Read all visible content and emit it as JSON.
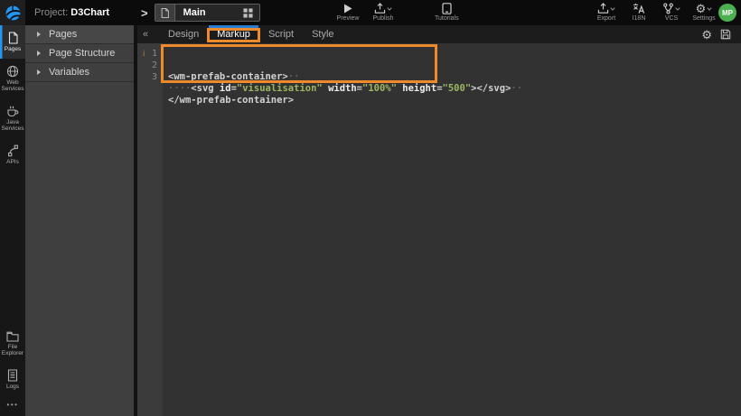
{
  "colors": {
    "annotation_orange": "#ee8a2b",
    "active_tab_blue": "#2b7cd3",
    "sidebar_active_blue": "#2196f3",
    "avatar_green": "#4caf50",
    "code_string_green": "#9db661"
  },
  "topbar": {
    "project_label": "Project:",
    "project_name": "D3Chart",
    "breadcrumb_chevron": ">",
    "file_tab": {
      "label": "Main"
    },
    "center_actions": [
      {
        "id": "preview",
        "label": "Preview",
        "icon": "play-icon",
        "caret": false
      },
      {
        "id": "publish",
        "label": "Publish",
        "icon": "publish-icon",
        "caret": true
      },
      {
        "id": "tutorials",
        "label": "Tutorials",
        "icon": "tutorials-icon",
        "caret": false
      }
    ],
    "right_actions": [
      {
        "id": "export",
        "label": "Export",
        "icon": "export-icon",
        "caret": true
      },
      {
        "id": "i18n",
        "label": "I18N",
        "icon": "i18n-icon",
        "caret": false
      },
      {
        "id": "vcs",
        "label": "VCS",
        "icon": "vcs-icon",
        "caret": true
      },
      {
        "id": "settings",
        "label": "Settings",
        "icon": "settings-icon",
        "caret": true
      }
    ],
    "avatar": {
      "initials": "MP"
    }
  },
  "sidebar": {
    "top_items": [
      {
        "id": "pages",
        "label": "Pages",
        "icon": "page-icon",
        "active": true
      },
      {
        "id": "web-services",
        "label": "Web Services",
        "icon": "globe-icon",
        "active": false
      },
      {
        "id": "java-services",
        "label": "Java Services",
        "icon": "coffee-icon",
        "active": false
      },
      {
        "id": "apis",
        "label": "APIs",
        "icon": "api-icon",
        "active": false
      }
    ],
    "bottom_items": [
      {
        "id": "file-explorer",
        "label": "File Explorer",
        "icon": "folder-icon"
      },
      {
        "id": "logs",
        "label": "Logs",
        "icon": "logs-icon"
      }
    ],
    "more": "•••"
  },
  "explorer_panel": {
    "collapse_icon": "«",
    "sections": [
      {
        "label": "Pages"
      },
      {
        "label": "Page Structure"
      },
      {
        "label": "Variables"
      }
    ]
  },
  "editor": {
    "tabs": [
      {
        "label": "Design",
        "active": false
      },
      {
        "label": "Markup",
        "active": true,
        "annotated": true
      },
      {
        "label": "Script",
        "active": false
      },
      {
        "label": "Style",
        "active": false
      }
    ],
    "toolbar": {
      "settings_icon": "gear-icon",
      "save_icon": "save-icon"
    },
    "gutter_marker": "i",
    "code_lines": [
      {
        "number": "1",
        "tokens": [
          [
            "tag",
            "<wm-prefab-container>"
          ],
          [
            "ws",
            "··"
          ]
        ]
      },
      {
        "number": "2",
        "tokens": [
          [
            "ws",
            "····"
          ],
          [
            "tag",
            "<svg"
          ],
          [
            "plain",
            " "
          ],
          [
            "attr",
            "id"
          ],
          [
            "eq",
            "="
          ],
          [
            "str",
            "\"visualisation\""
          ],
          [
            "plain",
            " "
          ],
          [
            "attr",
            "width"
          ],
          [
            "eq",
            "="
          ],
          [
            "str",
            "\"100%\""
          ],
          [
            "plain",
            " "
          ],
          [
            "attr",
            "height"
          ],
          [
            "eq",
            "="
          ],
          [
            "str",
            "\"500\""
          ],
          [
            "tag",
            "></svg>"
          ],
          [
            "ws",
            "··"
          ]
        ]
      },
      {
        "number": "3",
        "tokens": [
          [
            "tag",
            "</wm-prefab-container>"
          ]
        ]
      }
    ]
  }
}
